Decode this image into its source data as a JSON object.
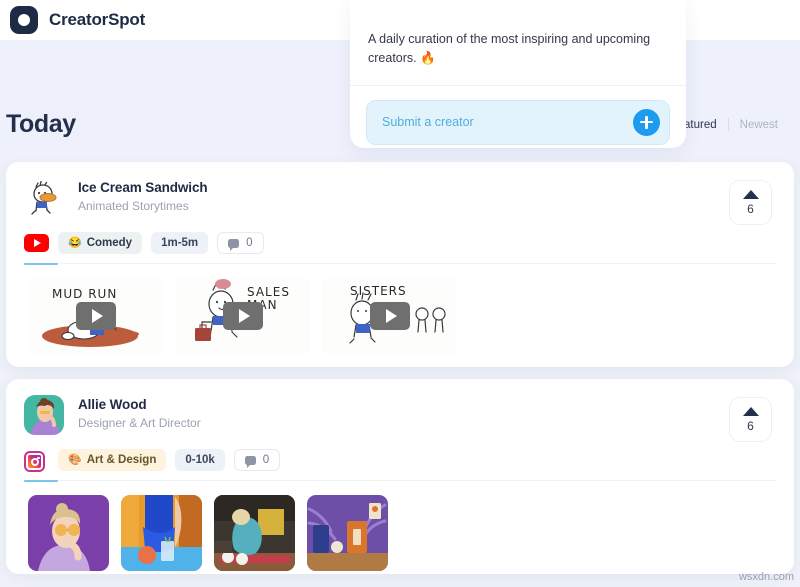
{
  "brand": {
    "name": "CreatorSpot",
    "logo_icon": "circle-mark-icon"
  },
  "hero": {
    "section_title": "Today"
  },
  "submit_panel": {
    "blurb": "A daily curation of the most inspiring and upcoming creators. 🔥",
    "input_placeholder": "Submit a creator",
    "add_icon": "plus-icon",
    "accent_color": "#1d9bf0"
  },
  "filters": {
    "tabs": [
      {
        "label": "Featured",
        "active": true
      },
      {
        "label": "Newest",
        "active": false
      }
    ]
  },
  "cards": [
    {
      "name": "Ice Cream Sandwich",
      "role": "Animated Storytimes",
      "platform": "youtube",
      "platform_icon": "youtube-icon",
      "category": {
        "emoji": "😂",
        "label": "Comedy"
      },
      "meta": "1m-5m",
      "comment_icon": "comment-bubble-icon",
      "comments": "0",
      "upvote_icon": "triangle-up-icon",
      "upvotes": "6",
      "media_type": "video",
      "media": [
        {
          "label": "MUD  RUN",
          "play_icon": "play-icon"
        },
        {
          "label": "SALES\nMAN",
          "play_icon": "play-icon"
        },
        {
          "label": "SISTERS",
          "play_icon": "play-icon"
        }
      ]
    },
    {
      "name": "Allie Wood",
      "role": "Designer & Art Director",
      "platform": "instagram",
      "platform_icon": "instagram-icon",
      "category": {
        "emoji": "🎨",
        "label": "Art & Design"
      },
      "meta": "0-10k",
      "comment_icon": "comment-bubble-icon",
      "comments": "0",
      "upvote_icon": "triangle-up-icon",
      "upvotes": "6",
      "media_type": "photo",
      "media": [
        {
          "label": ""
        },
        {
          "label": ""
        },
        {
          "label": ""
        },
        {
          "label": ""
        }
      ]
    }
  ],
  "watermark": "wsxdn.com"
}
